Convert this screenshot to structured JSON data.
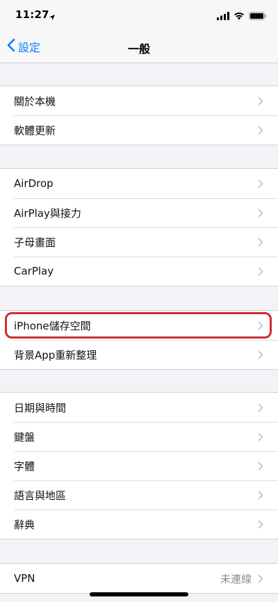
{
  "status_bar": {
    "time": "11:27",
    "icons": [
      "location-arrow-icon",
      "cellular-signal-icon",
      "wifi-icon",
      "battery-icon"
    ]
  },
  "nav": {
    "back_label": "設定",
    "title": "一般"
  },
  "groups": [
    [
      {
        "label": "關於本機"
      },
      {
        "label": "軟體更新"
      }
    ],
    [
      {
        "label": "AirDrop"
      },
      {
        "label": "AirPlay與接力"
      },
      {
        "label": "子母畫面"
      },
      {
        "label": "CarPlay"
      }
    ],
    [
      {
        "label": "iPhone儲存空間"
      },
      {
        "label": "背景App重新整理"
      }
    ],
    [
      {
        "label": "日期與時間"
      },
      {
        "label": "鍵盤"
      },
      {
        "label": "字體"
      },
      {
        "label": "語言與地區"
      },
      {
        "label": "辭典"
      }
    ],
    [
      {
        "label": "VPN",
        "value": "未連線"
      }
    ]
  ],
  "colors": {
    "accent": "#0a7aff",
    "highlight": "#d12a2f",
    "background": "#f2f2f7"
  }
}
